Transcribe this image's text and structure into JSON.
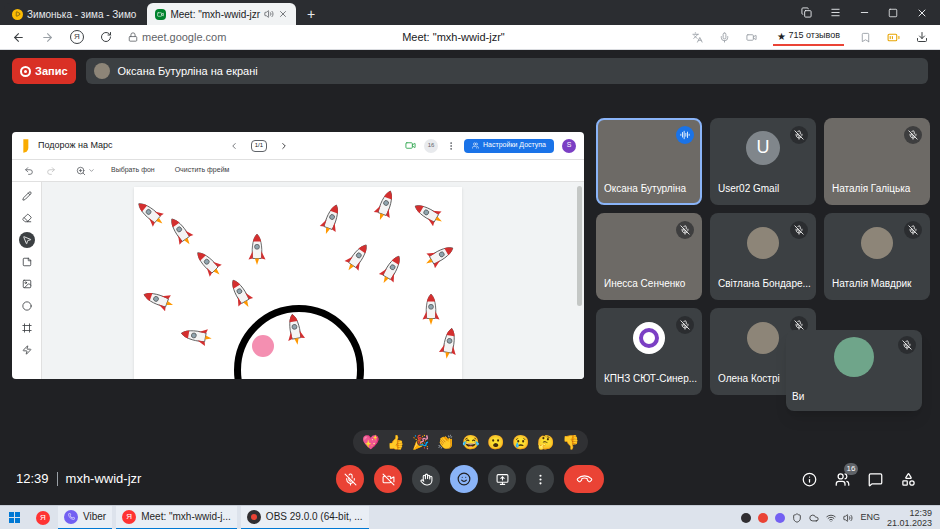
{
  "browser": {
    "yandex_logo": "Я",
    "tabs": [
      {
        "label": "Зимонька - зима - Зимо",
        "selected": false,
        "playing": false
      },
      {
        "label": "Meet: \"mxh-wwid-jzr",
        "selected": true,
        "playing": true
      }
    ],
    "new_tab": "+",
    "address": "meet.google.com",
    "page_title": "Meet: \"mxh-wwid-jzr\"",
    "rating_icon": "★",
    "reviews": "715 отзывов"
  },
  "meet": {
    "record_label": "Запис",
    "presenting_banner": "Оксана Бутурліна на екрані",
    "presentation": {
      "title": "Подорож на Марс",
      "page": "1/1",
      "viewers": "16",
      "share_button": "Настройки Доступа",
      "avatar": "S",
      "toolbar": [
        "Выбрать фон",
        "Очистить фрейм"
      ],
      "tools": [
        {
          "selected": false
        },
        {
          "selected": false
        },
        {
          "selected": true
        },
        {
          "selected": false
        },
        {
          "selected": false
        },
        {
          "selected": false
        },
        {
          "selected": false
        },
        {
          "selected": false
        }
      ]
    },
    "participants": [
      {
        "name": "Оксана Бутурліна",
        "kind": "video",
        "muted": false,
        "speaking": true,
        "initial": ""
      },
      {
        "name": "User02 Gmail",
        "kind": "letter",
        "muted": true,
        "speaking": false,
        "initial": "U"
      },
      {
        "name": "Наталія Галіцька",
        "kind": "video",
        "muted": true,
        "speaking": false,
        "initial": ""
      },
      {
        "name": "Инесса Сенченко",
        "kind": "video",
        "muted": true,
        "speaking": false,
        "initial": ""
      },
      {
        "name": "Світлана Бондаре...",
        "kind": "photo",
        "muted": true,
        "speaking": false,
        "initial": ""
      },
      {
        "name": "Наталія Мавдрик",
        "kind": "photo",
        "muted": true,
        "speaking": false,
        "initial": ""
      },
      {
        "name": "КПНЗ СЮТ-Синер...",
        "kind": "logo",
        "muted": true,
        "speaking": false,
        "initial": ""
      },
      {
        "name": "Олена Кострі",
        "kind": "photo",
        "muted": true,
        "speaking": false,
        "initial": ""
      }
    ],
    "self": {
      "name": "Ви",
      "muted": true
    },
    "reactions_open": true,
    "reactions": [
      "💖",
      "👍",
      "🎉",
      "👏",
      "😂",
      "😮",
      "😢",
      "🤔",
      "👎"
    ],
    "time": "12:39",
    "meeting_code": "mxh-wwid-jzr",
    "controls": {
      "mic_on": false,
      "camera_on": false,
      "hand_raised": false
    },
    "people_count": "16"
  },
  "taskbar": {
    "apps": [
      {
        "label": "Viber",
        "icon": "viber"
      },
      {
        "label": "Meet: \"mxh-wwid-j...",
        "icon": "yandex"
      },
      {
        "label": "OBS 29.0.0 (64-bit, ...",
        "icon": "obs"
      }
    ],
    "lang": "ENG",
    "time": "12:39",
    "date": "21.01.2023"
  }
}
